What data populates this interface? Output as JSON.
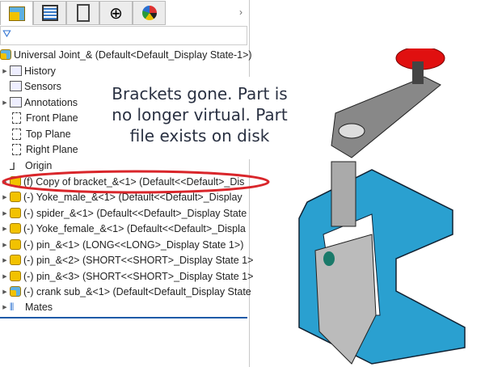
{
  "tabs": [
    {
      "icon": "feature-manager-icon"
    },
    {
      "icon": "property-manager-icon"
    },
    {
      "icon": "configuration-manager-icon"
    },
    {
      "icon": "dimxpert-icon"
    },
    {
      "icon": "display-manager-icon"
    }
  ],
  "tree": {
    "root": "Universal Joint_&  (Default<Default_Display State-1>)",
    "items": [
      {
        "label": "History"
      },
      {
        "label": "Sensors"
      },
      {
        "label": "Annotations"
      },
      {
        "label": "Front Plane"
      },
      {
        "label": "Top Plane"
      },
      {
        "label": "Right Plane"
      },
      {
        "label": "Origin"
      },
      {
        "label": "(f) Copy of bracket_&<1> (Default<<Default>_Dis"
      },
      {
        "label": "(-) Yoke_male_&<1> (Default<<Default>_Display"
      },
      {
        "label": "(-) spider_&<1> (Default<<Default>_Display State"
      },
      {
        "label": "(-) Yoke_female_&<1> (Default<<Default>_Displa"
      },
      {
        "label": "(-) pin_&<1> (LONG<<LONG>_Display State 1>)"
      },
      {
        "label": "(-) pin_&<2> (SHORT<<SHORT>_Display State 1>"
      },
      {
        "label": "(-) pin_&<3> (SHORT<<SHORT>_Display State 1>"
      },
      {
        "label": "(-) crank sub_&<1> (Default<Default_Display State"
      },
      {
        "label": "Mates"
      }
    ]
  },
  "callout": {
    "line1": "Brackets gone. Part is",
    "line2": "no longer virtual. Part",
    "line3": "file exists on disk"
  },
  "colors": {
    "highlight": "#d9262b",
    "bracket": "#2aa0d0",
    "knob": "#e01010"
  }
}
